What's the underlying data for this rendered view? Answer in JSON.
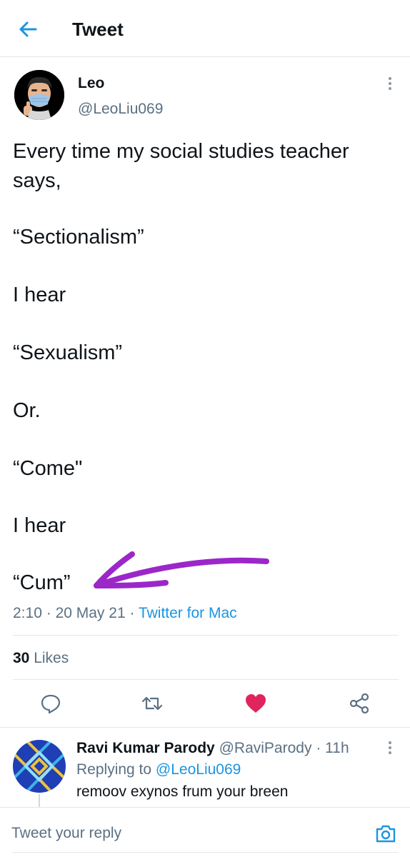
{
  "header": {
    "title": "Tweet",
    "back_icon": "arrow-left-icon"
  },
  "tweet": {
    "author_name": "Leo",
    "author_handle": "@LeoLiu069",
    "lines": [
      "Every time my social studies teacher",
      "says,",
      "“Sectionalism”",
      "I hear",
      "“Sexualism”",
      "Or.",
      "“Come\"",
      "I hear",
      "“Cum”"
    ],
    "time": "2:10",
    "date": "20 May 21",
    "separator": "·",
    "source": "Twitter for Mac",
    "likes_count": "30",
    "likes_label": "Likes",
    "liked": true,
    "annotation": "purple-arrow-drawing"
  },
  "actions": {
    "reply_icon": "comment-icon",
    "retweet_icon": "retweet-icon",
    "like_icon": "heart-filled-icon",
    "share_icon": "share-icon"
  },
  "reply": {
    "name": "Ravi Kumar Parody",
    "handle": "@RaviParody",
    "time": "11h",
    "separator": "·",
    "replying_prefix": "Replying to",
    "replying_handle": "@LeoLiu069",
    "text": "remoov exynos frum your breen"
  },
  "composer": {
    "placeholder": "Tweet your reply",
    "camera_icon": "camera-icon"
  },
  "colors": {
    "accent": "#1b95e0",
    "like": "#e0245e",
    "muted": "#5b7083",
    "annotation": "#9b27c9"
  }
}
